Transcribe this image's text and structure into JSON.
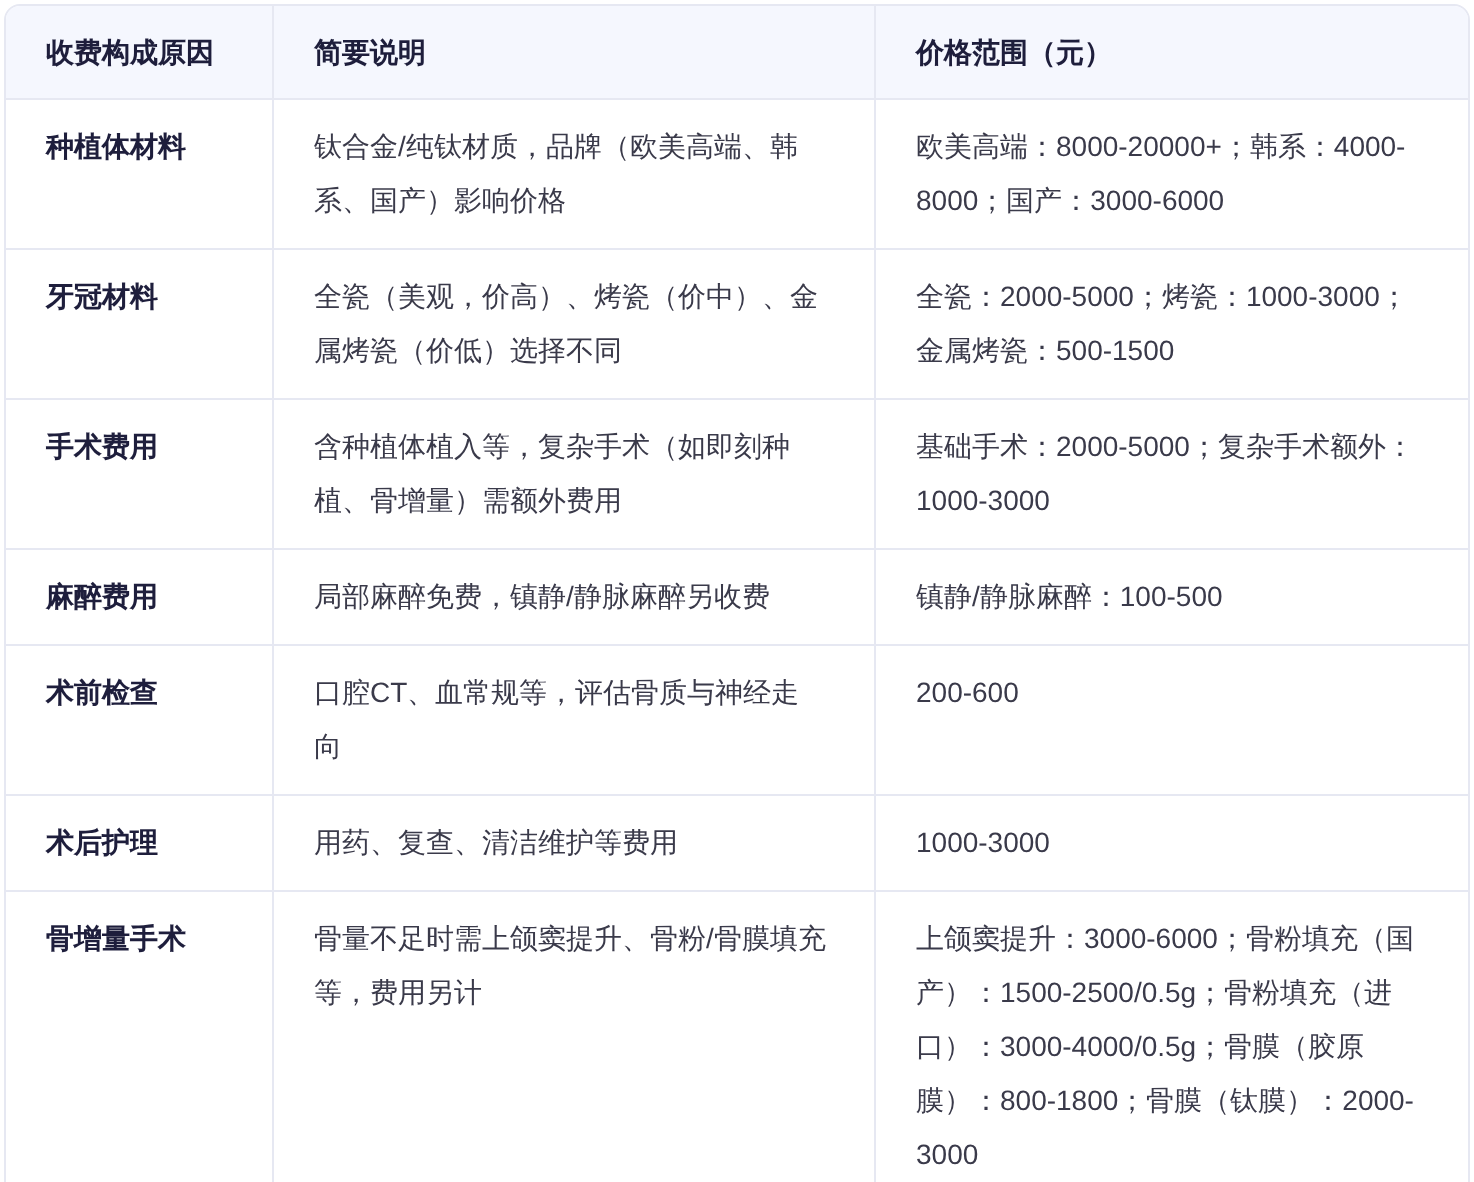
{
  "table": {
    "columns": [
      "收费构成原因",
      "简要说明",
      "价格范围（元）"
    ],
    "rows": [
      {
        "cells": [
          "种植体材料",
          "钛合金/纯钛材质，品牌（欧美高端、韩系、国产）影响价格",
          "欧美高端：8000-20000+；韩系：4000-8000；国产：3000-6000"
        ]
      },
      {
        "cells": [
          "牙冠材料",
          "全瓷（美观，价高）、烤瓷（价中）、金属烤瓷（价低）选择不同",
          "全瓷：2000-5000；烤瓷：1000-3000；金属烤瓷：500-1500"
        ]
      },
      {
        "cells": [
          "手术费用",
          "含种植体植入等，复杂手术（如即刻种植、骨增量）需额外费用",
          "基础手术：2000-5000；复杂手术额外：1000-3000"
        ]
      },
      {
        "cells": [
          "麻醉费用",
          "局部麻醉免费，镇静/静脉麻醉另收费",
          "镇静/静脉麻醉：100-500"
        ]
      },
      {
        "cells": [
          "术前检查",
          "口腔CT、血常规等，评估骨质与神经走向",
          "200-600"
        ]
      },
      {
        "cells": [
          "术后护理",
          "用药、复查、清洁维护等费用",
          "1000-3000"
        ]
      },
      {
        "cells": [
          "骨增量手术",
          "骨量不足时需上颌窦提升、骨粉/骨膜填充等，费用另计",
          "上颌窦提升：3000-6000；骨粉填充（国产）：1500-2500/0.5g；骨粉填充（进口）：3000-4000/0.5g；骨膜（胶原膜）：800-1800；骨膜（钛膜）：2000-3000"
        ]
      }
    ]
  }
}
